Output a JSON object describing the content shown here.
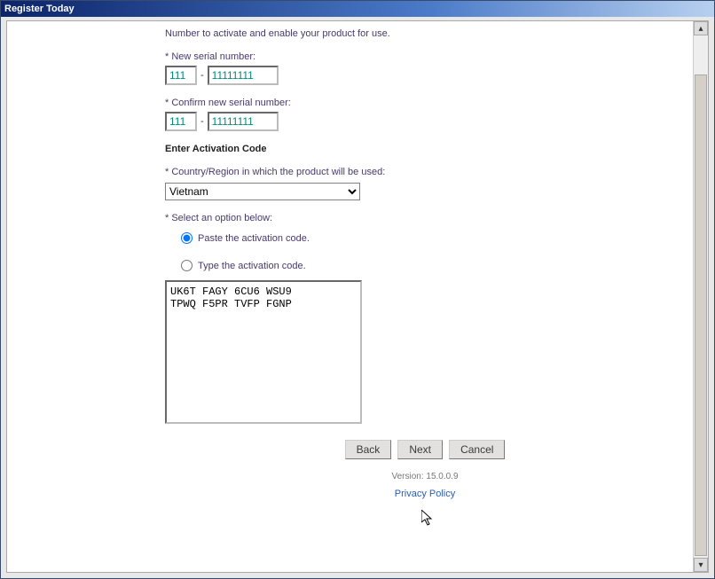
{
  "window": {
    "title": "Register Today"
  },
  "intro": {
    "top_text": "Number to activate and enable your product for use."
  },
  "serial": {
    "new_label": "New serial number:",
    "confirm_label": "Confirm new serial number:",
    "new_a": "111",
    "new_b": "11111111",
    "confirm_a": "111",
    "confirm_b": "11111111",
    "dash": "-"
  },
  "activation": {
    "section_title": "Enter Activation Code",
    "country_label": "Country/Region in which the product will be used:",
    "country_value": "Vietnam",
    "select_label": "Select an option below:",
    "opt_paste": "Paste the activation code.",
    "opt_type": "Type the activation code.",
    "selected_option": "paste",
    "code_text": "UK6T FAGY 6CU6 WSU9\nTPWQ F5PR TVFP FGNP"
  },
  "buttons": {
    "back": "Back",
    "next": "Next",
    "cancel": "Cancel"
  },
  "footer": {
    "version_label": "Version: 15.0.0.9",
    "privacy": "Privacy Policy"
  },
  "asterisk": "* "
}
